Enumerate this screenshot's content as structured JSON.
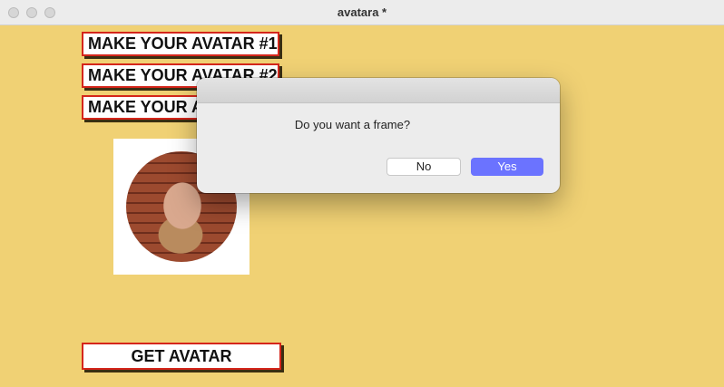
{
  "window": {
    "title": "avatara *"
  },
  "app": {
    "buttons": [
      {
        "label": "MAKE YOUR AVATAR #1"
      },
      {
        "label": "MAKE YOUR AVATAR #2"
      },
      {
        "label": "MAKE YOUR AVATAR #3"
      }
    ],
    "get_avatar_label": "GET AVATAR"
  },
  "dialog": {
    "message": "Do you want a frame?",
    "no_label": "No",
    "yes_label": "Yes"
  },
  "colors": {
    "background": "#f0d174",
    "button_border": "#d5261b",
    "yes_button": "#6b73ff"
  }
}
